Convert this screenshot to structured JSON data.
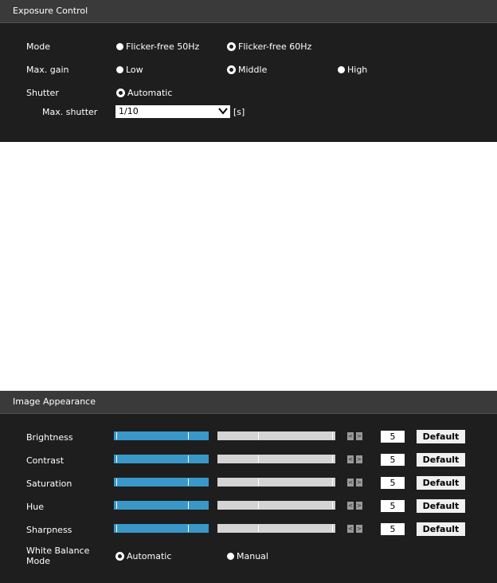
{
  "exposure": {
    "title": "Exposure Control",
    "mode": {
      "label": "Mode",
      "options": [
        "Flicker-free 50Hz",
        "Flicker-free 60Hz"
      ],
      "selected": "Flicker-free 60Hz"
    },
    "gain": {
      "label": "Max. gain",
      "options": [
        "Low",
        "Middle",
        "High"
      ],
      "selected": "Middle"
    },
    "shutter": {
      "label": "Shutter",
      "option": "Automatic",
      "selected": "Automatic"
    },
    "max_shutter": {
      "label": "Max. shutter",
      "value": "1/10",
      "unit": "[s]"
    }
  },
  "appearance": {
    "title": "Image Appearance",
    "sliders": [
      {
        "label": "Brightness",
        "value": "5",
        "default_label": "Default"
      },
      {
        "label": "Contrast",
        "value": "5",
        "default_label": "Default"
      },
      {
        "label": "Saturation",
        "value": "5",
        "default_label": "Default"
      },
      {
        "label": "Hue",
        "value": "5",
        "default_label": "Default"
      },
      {
        "label": "Sharpness",
        "value": "5",
        "default_label": "Default"
      }
    ],
    "white_balance": {
      "label_line1": "White Balance",
      "label_line2": "Mode",
      "options": [
        "Automatic",
        "Manual"
      ],
      "selected": "Automatic"
    }
  },
  "colors": {
    "panel": "#1e1e1e",
    "header": "#3a3a3a",
    "slider_fill": "#3a98c8",
    "slider_track": "#d4d4d4"
  }
}
